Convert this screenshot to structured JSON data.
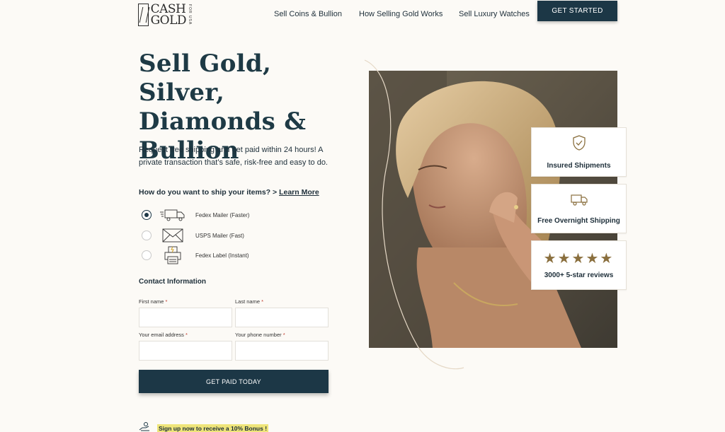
{
  "header": {
    "logo_top": "CASH",
    "logo_bottom": "GOLD",
    "logo_side": "FOR USA",
    "nav": [
      "Sell Coins & Bullion",
      "How Selling Gold Works",
      "Sell Luxury Watches"
    ],
    "cta": "GET STARTED"
  },
  "hero": {
    "headline_line1": "Sell Gold, Silver,",
    "headline_line2": "Diamonds &",
    "headline_line3": "Bullion",
    "subtext": "Request free shipping and get paid within 24 hours! A private transaction that’s safe, risk-free and easy to do."
  },
  "shipping": {
    "question": "How do you want to ship your items? > ",
    "learn_more": "Learn More",
    "options": [
      {
        "label": "Fedex Mailer (Faster)",
        "icon": "truck-icon",
        "selected": true
      },
      {
        "label": "USPS Mailer (Fast)",
        "icon": "envelope-icon",
        "selected": false
      },
      {
        "label": "Fedex Label (Instant)",
        "icon": "printer-icon",
        "selected": false
      }
    ]
  },
  "contact": {
    "heading": "Contact Information",
    "first_name_label": "First name",
    "last_name_label": "Last name",
    "email_label": "Your email address",
    "phone_label": "Your phone number",
    "required_mark": "*",
    "first_name_value": "",
    "last_name_value": "",
    "email_value": "",
    "phone_value": ""
  },
  "submit_label": "GET PAID TODAY",
  "bonus_text": "Sign up now to receive a 10% Bonus !",
  "badges": [
    {
      "label": "Insured Shipments",
      "icon": "shield-check-icon"
    },
    {
      "label": "Free Overnight Shipping",
      "icon": "delivery-truck-icon"
    },
    {
      "label": "3000+ 5-star reviews",
      "icon": "five-stars",
      "stars": "★★★★★",
      "rating": 5
    }
  ],
  "colors": {
    "primary": "#1c3746",
    "gold": "#8a6f3e",
    "highlight": "#efe57a",
    "background": "#fcfaf6"
  }
}
